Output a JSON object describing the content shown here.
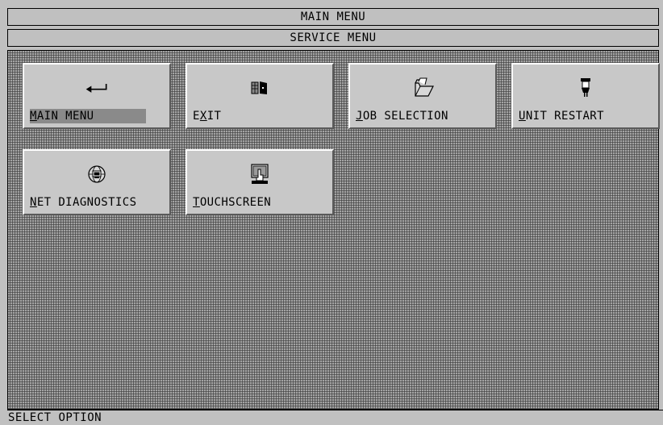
{
  "header": {
    "title": "MAIN MENU",
    "subtitle": "SERVICE MENU"
  },
  "tiles": [
    {
      "label_hot": "M",
      "label_rest": "AIN MENU",
      "icon": "return-arrow-icon",
      "selected": true
    },
    {
      "label_pre": "E",
      "label_hot": "X",
      "label_rest": "IT",
      "icon": "exit-door-icon"
    },
    {
      "label_hot": "J",
      "label_rest": "OB SELECTION",
      "icon": "folder-icon"
    },
    {
      "label_hot": "U",
      "label_rest": "NIT RESTART",
      "icon": "power-plug-icon"
    },
    {
      "label_hot": "N",
      "label_rest": "ET DIAGNOSTICS",
      "icon": "network-globe-icon"
    },
    {
      "label_hot": "T",
      "label_rest": "OUCHSCREEN",
      "icon": "touch-hand-icon"
    }
  ],
  "status": {
    "text": "SELECT OPTION"
  }
}
